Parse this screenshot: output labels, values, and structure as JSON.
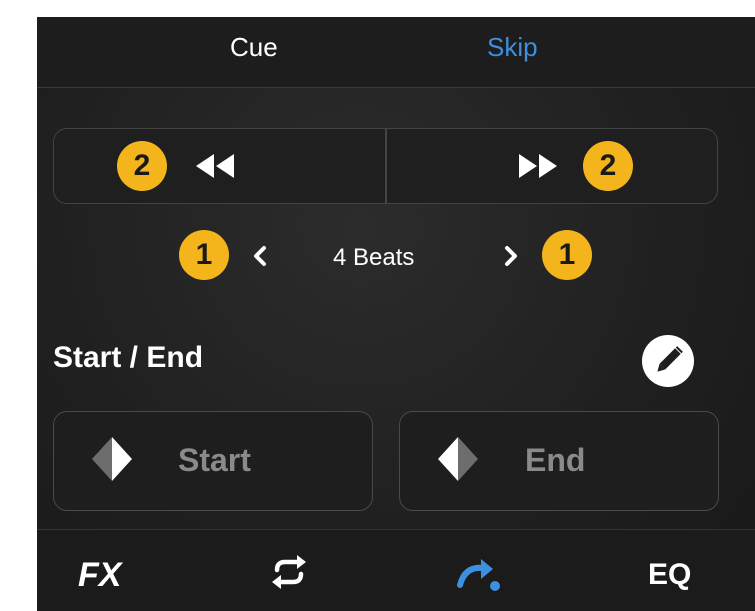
{
  "tabs": [
    {
      "label": "Cue",
      "active": false
    },
    {
      "label": "Skip",
      "active": true
    }
  ],
  "seek": {
    "back_badge": "2",
    "forward_badge": "2",
    "back_icon": "rewind-icon",
    "forward_icon": "fast-forward-icon"
  },
  "beats": {
    "label": "4 Beats",
    "left_badge": "1",
    "right_badge": "1"
  },
  "points": {
    "title": "Start / End",
    "start_label": "Start",
    "end_label": "End",
    "edit_icon": "pencil-icon"
  },
  "bottom_bar": {
    "fx_label": "FX",
    "eq_label": "EQ",
    "loop_icon": "loop-icon",
    "skip_icon": "skip-arrow-icon"
  },
  "colors": {
    "accent": "#3d8fe0",
    "badge": "#f4b51c",
    "background": "#202020"
  }
}
